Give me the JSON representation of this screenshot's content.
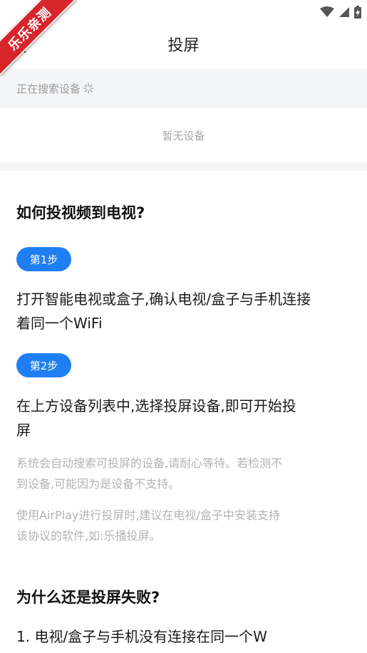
{
  "watermark": {
    "text": "乐乐亲测"
  },
  "header": {
    "title": "投屏"
  },
  "search": {
    "status_text": "正在搜索设备",
    "empty_text": "暂无设备"
  },
  "help": {
    "title": "如何投视频到电视?",
    "steps": [
      {
        "badge": "第1步",
        "line1": "打开智能电视或盒子,确认电视/盒子与手机连接",
        "line2": "着同一个WiFi"
      },
      {
        "badge": "第2步",
        "line1": "在上方设备列表中,选择投屏设备,即可开始投",
        "line2": "屏"
      }
    ],
    "notes": [
      {
        "line1": "系统会自动搜索可投屏的设备,请耐心等待。若检测不",
        "line2": "到设备,可能因为是设备不支持。"
      },
      {
        "line1": "使用AirPlay进行投屏时,建议在电视/盒子中安装支持",
        "line2": "该协议的软件,如:乐播投屏。"
      }
    ],
    "fail_title": "为什么还是投屏失败?",
    "fail_items": [
      "1. 电视/盒子与手机没有连接在同一个W"
    ]
  },
  "colors": {
    "accent": "#1f7ff2",
    "ribbon": "#d6262b",
    "band": "#f4f5f7"
  }
}
